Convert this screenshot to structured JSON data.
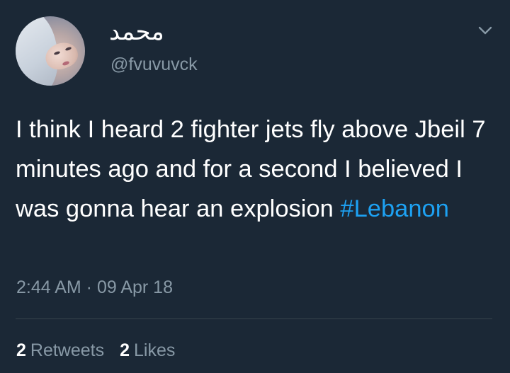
{
  "user": {
    "display_name": "محمد",
    "handle": "@fvuvuvck"
  },
  "tweet": {
    "text_before_hashtag": "I think I heard 2 fighter jets fly above Jbeil 7 minutes ago and for a second I believed I was gonna hear an explosion ",
    "hashtag": "#Lebanon",
    "time": "2:44 AM",
    "separator": " · ",
    "date": "09 Apr 18"
  },
  "stats": {
    "retweets_count": "2",
    "retweets_label": "Retweets",
    "likes_count": "2",
    "likes_label": "Likes"
  },
  "icons": {
    "menu": "chevron-down-icon"
  },
  "colors": {
    "background": "#1b2836",
    "hashtag": "#1da1f2",
    "secondary_text": "#8899a6",
    "divider": "#38444d"
  }
}
